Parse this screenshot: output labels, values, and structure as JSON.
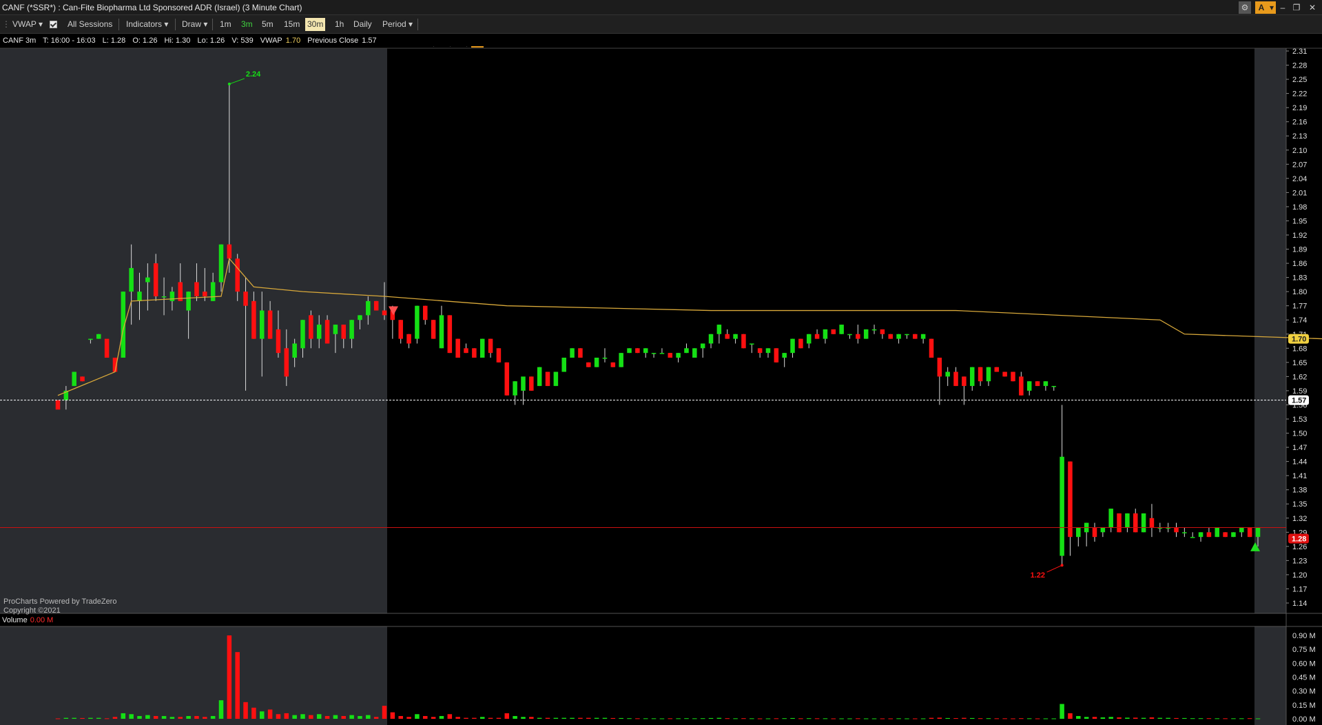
{
  "window": {
    "title": "CANF (*SSR*) : Can-Fite Biopharma Ltd Sponsored ADR (Israel) (3 Minute Chart)",
    "controls": [
      "⚙",
      "A",
      "▾",
      "–",
      "❐",
      "✕"
    ]
  },
  "toolbar": {
    "vwap": "VWAP",
    "all_sessions": "All Sessions",
    "indicators": "Indicators",
    "draw": "Draw",
    "tf_1m": "1m",
    "tf_3m": "3m",
    "tf_5m": "5m",
    "tf_15m": "15m",
    "tf_30m": "30m",
    "tf_1h": "1h",
    "daily": "Daily",
    "period": "Period",
    "zoom_out_icon": "zoom-out-icon",
    "zoom_in_icon": "zoom-in-icon",
    "reset_icon": "reset-zoom-icon",
    "highlight_icon": "alert-icon"
  },
  "info": {
    "symbol": "CANF 3m",
    "time": "T: 16:00 - 16:03",
    "low": "L: 1.28",
    "open": "O: 1.26",
    "high": "Hi: 1.30",
    "lo": "Lo: 1.26",
    "volume": "V: 539",
    "vwap_label": "VWAP",
    "vwap_value": "1.70",
    "prev_close_label": "Previous Close",
    "prev_close_value": "1.57"
  },
  "watermark": {
    "line1": "ProCharts Powered by TradeZero",
    "line2": "Copyright ©2021"
  },
  "volume_header": {
    "label": "Volume",
    "value": "0.00 M"
  },
  "colors": {
    "up": "#15e015",
    "down": "#ff1010",
    "vwap": "#d9a93a",
    "premarket": "#2a2c30",
    "bg": "#000000",
    "prev_close": "#ffffff",
    "last": "#cc1010"
  },
  "chart_data": {
    "type": "candlestick",
    "price_axis_ticks": [
      "2.31",
      "2.28",
      "2.25",
      "2.22",
      "2.19",
      "2.16",
      "2.13",
      "2.10",
      "2.07",
      "2.04",
      "2.01",
      "1.98",
      "1.95",
      "1.92",
      "1.89",
      "1.86",
      "1.83",
      "1.80",
      "1.77",
      "1.74",
      "1.71",
      "1.68",
      "1.65",
      "1.62",
      "1.59",
      "1.56",
      "1.53",
      "1.50",
      "1.47",
      "1.44",
      "1.41",
      "1.38",
      "1.35",
      "1.32",
      "1.29",
      "1.26",
      "1.23",
      "1.20",
      "1.17",
      "1.14"
    ],
    "volume_axis_ticks": [
      "0.90 M",
      "0.75 M",
      "0.60 M",
      "0.45 M",
      "0.30 M",
      "0.15 M",
      "0.00 M"
    ],
    "ylim": [
      1.14,
      2.31
    ],
    "vol_lim": [
      0,
      0.9
    ],
    "high_label": "2.24",
    "low_label": "1.22",
    "prev_close": 1.57,
    "prev_close_label": "1.57",
    "vwap_last": 1.7,
    "vwap_label": "1.70",
    "last_price": 1.3,
    "last_label": "1.28",
    "candles": [
      [
        1.57,
        1.57,
        1.56,
        1.55,
        0.004
      ],
      [
        1.57,
        1.6,
        1.55,
        1.59,
        0.01
      ],
      [
        1.6,
        1.63,
        1.6,
        1.63,
        0.01
      ],
      [
        1.62,
        1.62,
        1.61,
        1.61,
        0.008
      ],
      [
        1.7,
        1.7,
        1.69,
        1.7,
        0.01
      ],
      [
        1.7,
        1.71,
        1.7,
        1.71,
        0.01
      ],
      [
        1.7,
        1.69,
        1.66,
        1.66,
        0.005
      ],
      [
        1.66,
        1.66,
        1.63,
        1.63,
        0.02
      ],
      [
        1.66,
        1.8,
        1.66,
        1.8,
        0.06
      ],
      [
        1.8,
        1.9,
        1.73,
        1.85,
        0.05
      ],
      [
        1.78,
        1.84,
        1.74,
        1.8,
        0.03
      ],
      [
        1.82,
        1.86,
        1.76,
        1.83,
        0.04
      ],
      [
        1.86,
        1.88,
        1.78,
        1.79,
        0.03
      ],
      [
        1.79,
        1.83,
        1.75,
        1.79,
        0.03
      ],
      [
        1.78,
        1.81,
        1.76,
        1.8,
        0.02
      ],
      [
        1.82,
        1.86,
        1.78,
        1.78,
        0.02
      ],
      [
        1.76,
        1.8,
        1.7,
        1.8,
        0.03
      ],
      [
        1.82,
        1.86,
        1.78,
        1.79,
        0.03
      ],
      [
        1.8,
        1.85,
        1.78,
        1.79,
        0.02
      ],
      [
        1.78,
        1.84,
        1.78,
        1.82,
        0.03
      ],
      [
        1.82,
        1.9,
        1.8,
        1.9,
        0.2
      ],
      [
        1.9,
        2.24,
        1.84,
        1.87,
        0.9
      ],
      [
        1.87,
        1.88,
        1.78,
        1.8,
        0.72
      ],
      [
        1.8,
        1.83,
        1.59,
        1.77,
        0.18
      ],
      [
        1.78,
        1.8,
        1.7,
        1.7,
        0.12
      ],
      [
        1.7,
        1.8,
        1.62,
        1.76,
        0.08
      ],
      [
        1.76,
        1.78,
        1.7,
        1.7,
        0.1
      ],
      [
        1.72,
        1.76,
        1.66,
        1.67,
        0.05
      ],
      [
        1.68,
        1.72,
        1.6,
        1.62,
        0.06
      ],
      [
        1.66,
        1.7,
        1.64,
        1.69,
        0.04
      ],
      [
        1.68,
        1.74,
        1.66,
        1.74,
        0.05
      ],
      [
        1.75,
        1.76,
        1.68,
        1.7,
        0.04
      ],
      [
        1.7,
        1.75,
        1.68,
        1.73,
        0.05
      ],
      [
        1.74,
        1.75,
        1.69,
        1.69,
        0.03
      ],
      [
        1.71,
        1.73,
        1.67,
        1.73,
        0.04
      ],
      [
        1.73,
        1.73,
        1.68,
        1.7,
        0.03
      ],
      [
        1.7,
        1.74,
        1.68,
        1.74,
        0.04
      ],
      [
        1.74,
        1.75,
        1.72,
        1.75,
        0.03
      ],
      [
        1.75,
        1.79,
        1.73,
        1.78,
        0.04
      ],
      [
        1.78,
        1.78,
        1.76,
        1.76,
        0.02
      ],
      [
        1.76,
        1.82,
        1.74,
        1.75,
        0.14
      ],
      [
        1.76,
        1.77,
        1.7,
        1.74,
        0.07
      ],
      [
        1.74,
        1.74,
        1.69,
        1.7,
        0.03
      ],
      [
        1.71,
        1.71,
        1.68,
        1.69,
        0.02
      ],
      [
        1.7,
        1.77,
        1.69,
        1.77,
        0.05
      ],
      [
        1.77,
        1.77,
        1.73,
        1.74,
        0.03
      ],
      [
        1.74,
        1.74,
        1.7,
        1.7,
        0.02
      ],
      [
        1.68,
        1.77,
        1.68,
        1.75,
        0.03
      ],
      [
        1.75,
        1.75,
        1.67,
        1.67,
        0.05
      ],
      [
        1.7,
        1.7,
        1.66,
        1.66,
        0.02
      ],
      [
        1.68,
        1.69,
        1.67,
        1.67,
        0.01
      ],
      [
        1.68,
        1.68,
        1.66,
        1.66,
        0.01
      ],
      [
        1.66,
        1.7,
        1.66,
        1.7,
        0.02
      ],
      [
        1.7,
        1.7,
        1.66,
        1.67,
        0.01
      ],
      [
        1.68,
        1.68,
        1.65,
        1.65,
        0.01
      ],
      [
        1.65,
        1.65,
        1.58,
        1.58,
        0.06
      ],
      [
        1.58,
        1.61,
        1.56,
        1.61,
        0.03
      ],
      [
        1.59,
        1.61,
        1.56,
        1.62,
        0.02
      ],
      [
        1.62,
        1.62,
        1.59,
        1.59,
        0.02
      ],
      [
        1.6,
        1.64,
        1.6,
        1.64,
        0.01
      ],
      [
        1.63,
        1.63,
        1.6,
        1.6,
        0.01
      ],
      [
        1.6,
        1.63,
        1.6,
        1.63,
        0.01
      ],
      [
        1.63,
        1.66,
        1.63,
        1.66,
        0.01
      ],
      [
        1.66,
        1.68,
        1.66,
        1.68,
        0.01
      ],
      [
        1.68,
        1.68,
        1.66,
        1.66,
        0.01
      ],
      [
        1.65,
        1.65,
        1.64,
        1.64,
        0.01
      ],
      [
        1.64,
        1.66,
        1.64,
        1.66,
        0.01
      ],
      [
        1.66,
        1.68,
        1.65,
        1.66,
        0.01
      ],
      [
        1.65,
        1.65,
        1.64,
        1.64,
        0.008
      ],
      [
        1.64,
        1.67,
        1.64,
        1.67,
        0.008
      ],
      [
        1.67,
        1.68,
        1.67,
        1.68,
        0.006
      ],
      [
        1.68,
        1.68,
        1.67,
        1.67,
        0.005
      ],
      [
        1.67,
        1.68,
        1.66,
        1.68,
        0.005
      ],
      [
        1.67,
        1.67,
        1.66,
        1.67,
        0.005
      ],
      [
        1.67,
        1.68,
        1.67,
        1.67,
        0.004
      ],
      [
        1.67,
        1.67,
        1.66,
        1.66,
        0.005
      ],
      [
        1.66,
        1.67,
        1.65,
        1.67,
        0.005
      ],
      [
        1.67,
        1.69,
        1.67,
        1.68,
        0.006
      ],
      [
        1.66,
        1.68,
        1.66,
        1.68,
        0.005
      ],
      [
        1.68,
        1.69,
        1.66,
        1.69,
        0.006
      ],
      [
        1.69,
        1.71,
        1.68,
        1.71,
        0.008
      ],
      [
        1.71,
        1.73,
        1.69,
        1.73,
        0.01
      ],
      [
        1.71,
        1.72,
        1.7,
        1.7,
        0.006
      ],
      [
        1.7,
        1.71,
        1.69,
        1.71,
        0.005
      ],
      [
        1.71,
        1.71,
        1.68,
        1.68,
        0.006
      ],
      [
        1.69,
        1.69,
        1.67,
        1.69,
        0.005
      ],
      [
        1.68,
        1.68,
        1.66,
        1.67,
        0.004
      ],
      [
        1.67,
        1.68,
        1.66,
        1.68,
        0.004
      ],
      [
        1.68,
        1.68,
        1.65,
        1.65,
        0.005
      ],
      [
        1.66,
        1.67,
        1.64,
        1.67,
        0.006
      ],
      [
        1.67,
        1.7,
        1.66,
        1.7,
        0.008
      ],
      [
        1.7,
        1.7,
        1.68,
        1.68,
        0.005
      ],
      [
        1.69,
        1.71,
        1.68,
        1.71,
        0.006
      ],
      [
        1.71,
        1.72,
        1.7,
        1.7,
        0.005
      ],
      [
        1.7,
        1.72,
        1.69,
        1.72,
        0.005
      ],
      [
        1.72,
        1.72,
        1.71,
        1.71,
        0.004
      ],
      [
        1.71,
        1.73,
        1.71,
        1.73,
        0.004
      ],
      [
        1.71,
        1.71,
        1.7,
        1.71,
        0.004
      ],
      [
        1.71,
        1.73,
        1.69,
        1.7,
        0.005
      ],
      [
        1.7,
        1.72,
        1.7,
        1.72,
        0.004
      ],
      [
        1.72,
        1.73,
        1.71,
        1.72,
        0.004
      ],
      [
        1.72,
        1.72,
        1.7,
        1.71,
        0.004
      ],
      [
        1.71,
        1.71,
        1.7,
        1.7,
        0.004
      ],
      [
        1.7,
        1.71,
        1.69,
        1.71,
        0.005
      ],
      [
        1.71,
        1.71,
        1.7,
        1.71,
        0.004
      ],
      [
        1.71,
        1.71,
        1.7,
        1.7,
        0.004
      ],
      [
        1.7,
        1.71,
        1.69,
        1.71,
        0.004
      ],
      [
        1.7,
        1.7,
        1.66,
        1.66,
        0.01
      ],
      [
        1.66,
        1.66,
        1.56,
        1.62,
        0.012
      ],
      [
        1.62,
        1.64,
        1.6,
        1.63,
        0.008
      ],
      [
        1.63,
        1.64,
        1.6,
        1.6,
        0.007
      ],
      [
        1.62,
        1.62,
        1.56,
        1.6,
        0.01
      ],
      [
        1.6,
        1.64,
        1.59,
        1.64,
        0.008
      ],
      [
        1.64,
        1.64,
        1.6,
        1.61,
        0.006
      ],
      [
        1.61,
        1.64,
        1.6,
        1.64,
        0.006
      ],
      [
        1.64,
        1.64,
        1.63,
        1.63,
        0.005
      ],
      [
        1.63,
        1.63,
        1.62,
        1.62,
        0.005
      ],
      [
        1.63,
        1.63,
        1.61,
        1.61,
        0.004
      ],
      [
        1.62,
        1.63,
        1.58,
        1.58,
        0.006
      ],
      [
        1.59,
        1.61,
        1.58,
        1.61,
        0.005
      ],
      [
        1.61,
        1.61,
        1.6,
        1.6,
        0.004
      ],
      [
        1.6,
        1.61,
        1.59,
        1.61,
        0.004
      ],
      [
        1.6,
        1.6,
        1.59,
        1.6,
        0.004
      ],
      [
        1.24,
        1.56,
        1.22,
        1.45,
        0.16
      ],
      [
        1.44,
        1.44,
        1.24,
        1.28,
        0.06
      ],
      [
        1.28,
        1.3,
        1.26,
        1.3,
        0.03
      ],
      [
        1.29,
        1.31,
        1.26,
        1.31,
        0.02
      ],
      [
        1.3,
        1.31,
        1.27,
        1.28,
        0.02
      ],
      [
        1.29,
        1.3,
        1.28,
        1.3,
        0.015
      ],
      [
        1.3,
        1.34,
        1.29,
        1.34,
        0.02
      ],
      [
        1.33,
        1.33,
        1.29,
        1.29,
        0.015
      ],
      [
        1.3,
        1.33,
        1.29,
        1.33,
        0.012
      ],
      [
        1.33,
        1.34,
        1.29,
        1.29,
        0.012
      ],
      [
        1.29,
        1.33,
        1.29,
        1.33,
        0.01
      ],
      [
        1.32,
        1.35,
        1.28,
        1.3,
        0.015
      ],
      [
        1.3,
        1.31,
        1.29,
        1.3,
        0.01
      ],
      [
        1.3,
        1.31,
        1.29,
        1.3,
        0.01
      ],
      [
        1.3,
        1.31,
        1.28,
        1.29,
        0.008
      ],
      [
        1.29,
        1.3,
        1.28,
        1.29,
        0.008
      ],
      [
        1.28,
        1.29,
        1.28,
        1.28,
        0.006
      ],
      [
        1.28,
        1.29,
        1.27,
        1.29,
        0.006
      ],
      [
        1.29,
        1.3,
        1.28,
        1.28,
        0.006
      ],
      [
        1.28,
        1.3,
        1.28,
        1.3,
        0.005
      ],
      [
        1.29,
        1.29,
        1.28,
        1.28,
        0.005
      ],
      [
        1.28,
        1.29,
        1.28,
        1.29,
        0.005
      ],
      [
        1.29,
        1.3,
        1.28,
        1.3,
        0.005
      ],
      [
        1.3,
        1.3,
        1.28,
        1.28,
        0.006
      ],
      [
        1.28,
        1.3,
        1.26,
        1.3,
        0.004
      ]
    ],
    "vwap_line": [
      [
        0,
        1.58
      ],
      [
        7,
        1.63
      ],
      [
        8,
        1.72
      ],
      [
        9,
        1.78
      ],
      [
        20,
        1.79
      ],
      [
        21,
        1.87
      ],
      [
        24,
        1.81
      ],
      [
        30,
        1.8
      ],
      [
        40,
        1.79
      ],
      [
        55,
        1.77
      ],
      [
        80,
        1.76
      ],
      [
        110,
        1.76
      ],
      [
        135,
        1.74
      ],
      [
        138,
        1.71
      ],
      [
        155,
        1.7
      ]
    ]
  }
}
